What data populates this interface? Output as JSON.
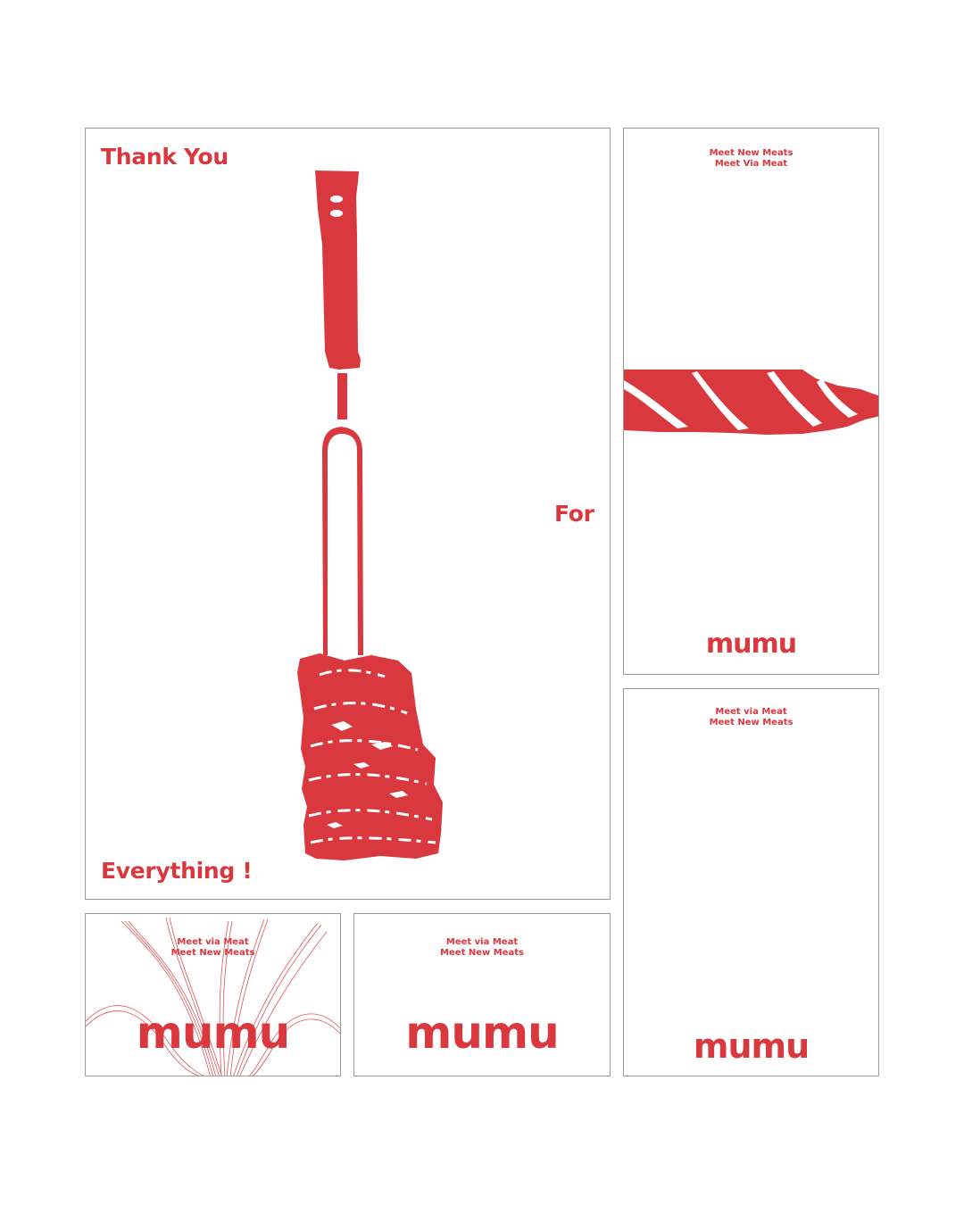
{
  "poster_main": {
    "line1": "Thank You",
    "line2": "For",
    "line3": "Everything !"
  },
  "card_top_right": {
    "tagline1": "Meet New Meats",
    "tagline2": "Meet Via Meat",
    "logo": "mumu"
  },
  "card_bottom_right": {
    "tagline1": "Meet via Meat",
    "tagline2": "Meet New Meats",
    "logo": "mumu"
  },
  "card_bottom_left": {
    "tagline1": "Meet via Meat",
    "tagline2": "Meet New Meats",
    "logo": "mumu"
  },
  "card_bottom_middle": {
    "tagline1": "Meet via Meat",
    "tagline2": "Meet New Meats",
    "logo": "mumu"
  },
  "colors": {
    "accent": "#d9383e",
    "border": "#9a9a9a",
    "background": "#ffffff"
  }
}
